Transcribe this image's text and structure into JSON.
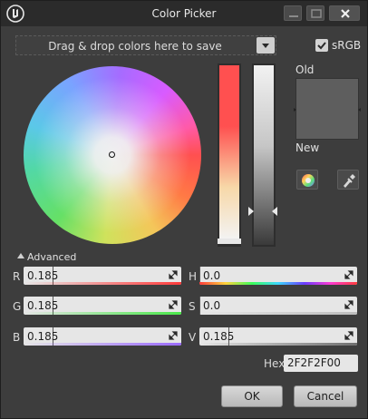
{
  "window": {
    "title": "Color Picker"
  },
  "toolbar": {
    "save_bar_text": "Drag & drop colors here to save",
    "srgb_label": "sRGB",
    "srgb_checked": true
  },
  "preview": {
    "old_label": "Old",
    "new_label": "New",
    "old_color": "#5e5e5e",
    "new_color": "#5e5e5e"
  },
  "advanced": {
    "label": "Advanced",
    "rows": [
      {
        "label": "R",
        "value": "0.185",
        "level": 0.185,
        "strip": "#ff3b3b"
      },
      {
        "label": "G",
        "value": "0.185",
        "level": 0.185,
        "strip": "#49e849"
      },
      {
        "label": "B",
        "value": "0.185",
        "level": 0.185,
        "strip": "#9b6bff"
      },
      {
        "label": "H",
        "value": "0.0",
        "level": 0.0,
        "strip": "hue"
      },
      {
        "label": "S",
        "value": "0.0",
        "level": 0.0,
        "strip": "#bdbdbd"
      },
      {
        "label": "V",
        "value": "0.185",
        "level": 0.185,
        "strip": "#6f6f6f"
      }
    ],
    "hex_label": "Hex",
    "hex_value": "2F2F2F00"
  },
  "buttons": {
    "ok": "OK",
    "cancel": "Cancel"
  },
  "colors": {
    "titlebar": "#2b2b2b",
    "panel": "#3d3d3d",
    "field": "#e6e6e6"
  }
}
